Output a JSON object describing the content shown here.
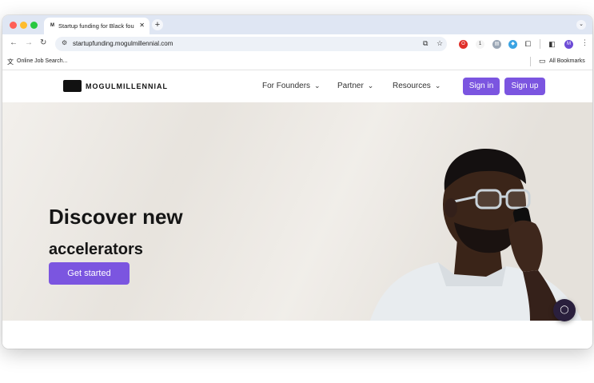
{
  "browser": {
    "tab_title": "Startup funding for Black fou",
    "tab_favicon": "M",
    "url": "startupfunding.mogulmillennial.com",
    "bookmark_item": "Online Job Search...",
    "all_bookmarks": "All Bookmarks",
    "profile_initial": "M"
  },
  "site": {
    "logo_text": "MOGULMILLENNIAL",
    "nav": [
      "For Founders",
      "Partner",
      "Resources"
    ],
    "sign_in": "Sign in",
    "sign_up": "Sign up"
  },
  "hero": {
    "title": "Discover new",
    "subtitle": "accelerators",
    "cta": "Get started"
  },
  "colors": {
    "accent": "#7b55e0",
    "hero_bg": "#ece8e2",
    "fab": "#2a1f3d"
  }
}
